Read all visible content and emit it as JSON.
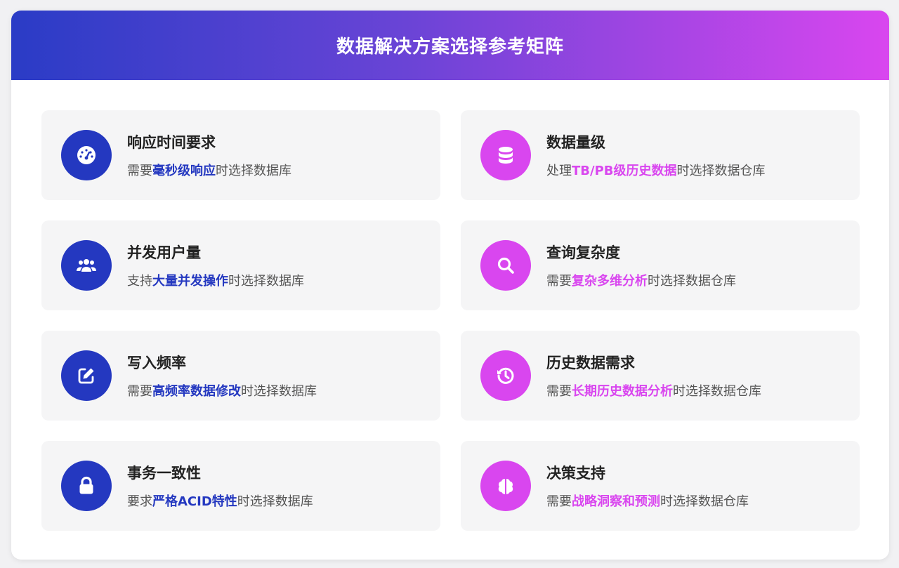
{
  "header": {
    "title": "数据解决方案选择参考矩阵"
  },
  "items": [
    {
      "icon": "gauge-icon",
      "title": "响应时间要求",
      "prefix": "需要",
      "highlight": "毫秒级响应",
      "suffix": "时选择数据库"
    },
    {
      "icon": "database-icon",
      "title": "数据量级",
      "prefix": "处理",
      "highlight": "TB/PB级历史数据",
      "suffix": "时选择数据仓库"
    },
    {
      "icon": "users-icon",
      "title": "并发用户量",
      "prefix": "支持",
      "highlight": "大量并发操作",
      "suffix": "时选择数据库"
    },
    {
      "icon": "search-icon",
      "title": "查询复杂度",
      "prefix": "需要",
      "highlight": "复杂多维分析",
      "suffix": "时选择数据仓库"
    },
    {
      "icon": "edit-icon",
      "title": "写入频率",
      "prefix": "需要",
      "highlight": "高频率数据修改",
      "suffix": "时选择数据库"
    },
    {
      "icon": "history-icon",
      "title": "历史数据需求",
      "prefix": "需要",
      "highlight": "长期历史数据分析",
      "suffix": "时选择数据仓库"
    },
    {
      "icon": "lock-icon",
      "title": "事务一致性",
      "prefix": "要求",
      "highlight": "严格ACID特性",
      "suffix": "时选择数据库"
    },
    {
      "icon": "brain-icon",
      "title": "决策支持",
      "prefix": "需要",
      "highlight": "战略洞察和预测",
      "suffix": "时选择数据仓库"
    }
  ],
  "colors": {
    "database_accent": "#2438c0",
    "warehouse_accent": "#d946ef"
  }
}
